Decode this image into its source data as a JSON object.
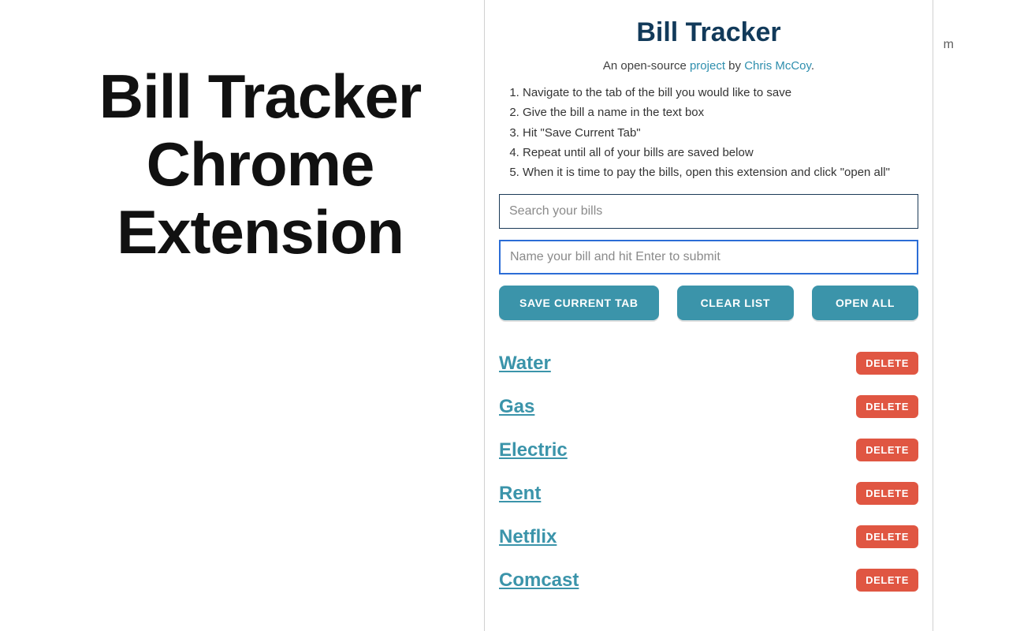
{
  "promo": {
    "line1": "Bill Tracker",
    "line2": "Chrome",
    "line3": "Extension"
  },
  "header": {
    "title": "Bill Tracker",
    "subtitle_prefix": "An open-source ",
    "subtitle_link1": "project",
    "subtitle_middle": " by ",
    "subtitle_link2": "Chris McCoy",
    "subtitle_suffix": "."
  },
  "instructions": [
    "Navigate to the tab of the bill you would like to save",
    "Give the bill a name in the text box",
    "Hit \"Save Current Tab\"",
    "Repeat until all of your bills are saved below",
    "When it is time to pay the bills, open this extension and click \"open all\""
  ],
  "inputs": {
    "search_placeholder": "Search your bills",
    "name_placeholder": "Name your bill and hit Enter to submit"
  },
  "buttons": {
    "save": "SAVE CURRENT TAB",
    "clear": "CLEAR LIST",
    "open_all": "OPEN ALL",
    "delete": "DELETE"
  },
  "bills": [
    {
      "name": "Water"
    },
    {
      "name": "Gas"
    },
    {
      "name": "Electric"
    },
    {
      "name": "Rent"
    },
    {
      "name": "Netflix"
    },
    {
      "name": "Comcast"
    }
  ],
  "colors": {
    "accent": "#3b94aa",
    "danger": "#e05642",
    "title": "#123a5a",
    "focus": "#2b6dd6"
  },
  "background": {
    "stray_letter": "m"
  }
}
